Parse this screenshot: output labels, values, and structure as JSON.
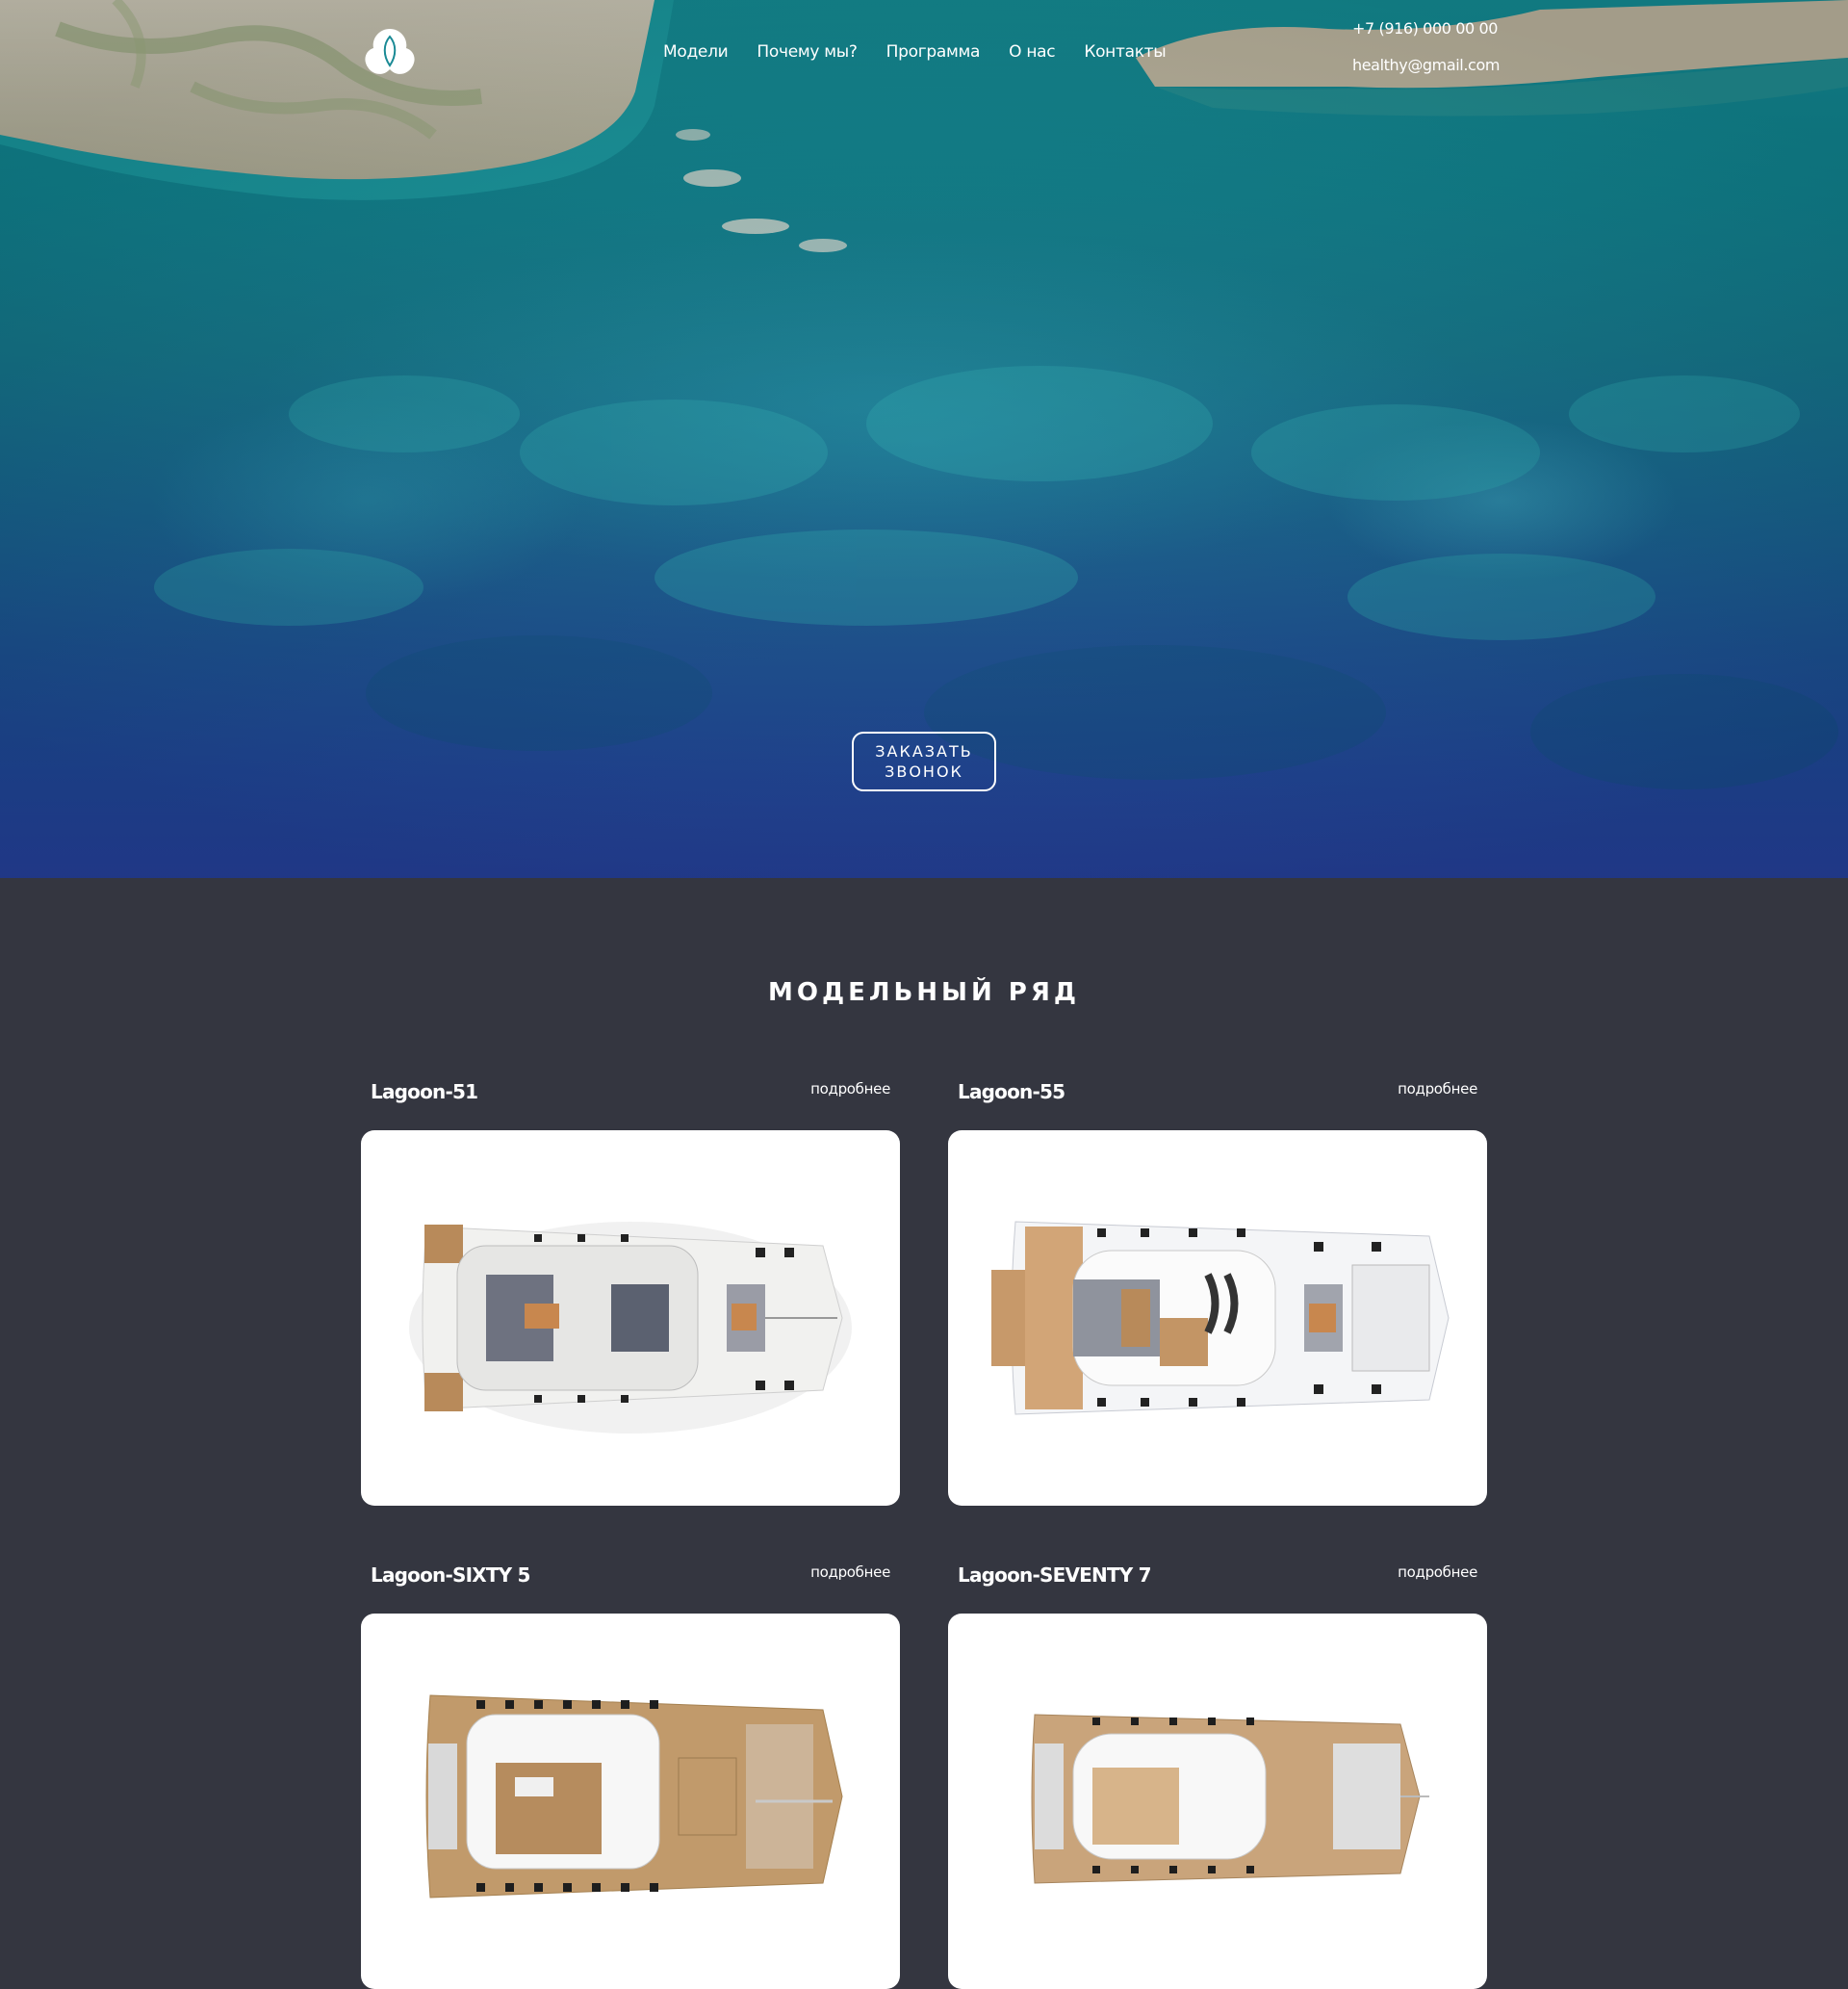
{
  "header": {
    "nav": [
      "Модели",
      "Почему мы?",
      "Программа",
      "О нас",
      "Контакты"
    ],
    "phone": "+7 (916) 000 00 00",
    "email": "healthy@gmail.com"
  },
  "hero": {
    "cta_label": "ЗАКАЗАТЬ ЗВОНОК"
  },
  "models": {
    "title": "МОДЕЛЬНЫЙ РЯД",
    "more_label": "подробнее",
    "items": [
      {
        "name": "Lagoon-51"
      },
      {
        "name": "Lagoon-55"
      },
      {
        "name": "Lagoon-SIXTY 5"
      },
      {
        "name": "Lagoon-SEVENTY 7"
      }
    ]
  }
}
